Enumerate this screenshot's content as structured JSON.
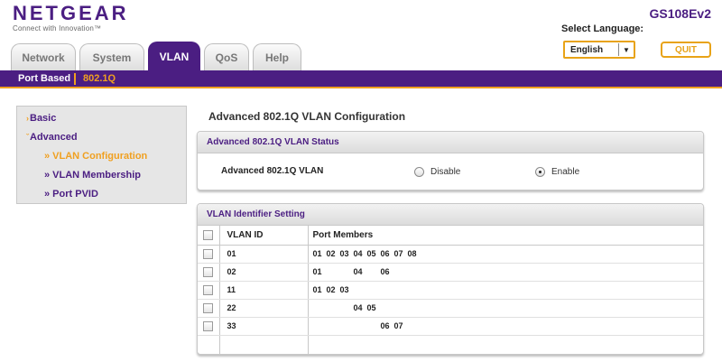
{
  "header": {
    "brand": "NETGEAR",
    "tagline": "Connect with Innovation™",
    "model": "GS108Ev2",
    "language_label": "Select Language:",
    "language_value": "English",
    "quit_label": "QUIT"
  },
  "tabs": [
    {
      "label": "Network",
      "active": false
    },
    {
      "label": "System",
      "active": false
    },
    {
      "label": "VLAN",
      "active": true
    },
    {
      "label": "QoS",
      "active": false
    },
    {
      "label": "Help",
      "active": false
    }
  ],
  "subnav": {
    "port_based": "Port Based",
    "dot1q": "802.1Q"
  },
  "leftmenu": {
    "basic": "Basic",
    "advanced": "Advanced",
    "vlan_configuration": "» VLAN Configuration",
    "vlan_membership": "» VLAN Membership",
    "port_pvid": "» Port PVID"
  },
  "main": {
    "title": "Advanced 802.1Q VLAN Configuration",
    "status_panel": {
      "heading": "Advanced 802.1Q VLAN Status",
      "label": "Advanced 802.1Q VLAN",
      "disable": "Disable",
      "enable": "Enable",
      "selected": "enable"
    },
    "vlan_panel": {
      "heading": "VLAN Identifier Setting",
      "col_vlan_id": "VLAN ID",
      "col_port_members": "Port Members",
      "rows": [
        {
          "id": "01",
          "ports": [
            "01",
            "02",
            "03",
            "04",
            "05",
            "06",
            "07",
            "08"
          ]
        },
        {
          "id": "02",
          "ports": [
            "01",
            "",
            "",
            "04",
            "",
            "06",
            "",
            ""
          ]
        },
        {
          "id": "11",
          "ports": [
            "01",
            "02",
            "03",
            "",
            "",
            "",
            "",
            ""
          ]
        },
        {
          "id": "22",
          "ports": [
            "",
            "",
            "",
            "04",
            "05",
            "",
            "",
            ""
          ]
        },
        {
          "id": "33",
          "ports": [
            "",
            "",
            "",
            "",
            "",
            "06",
            "07",
            ""
          ]
        }
      ]
    }
  },
  "colors": {
    "brand_purple": "#4b1e82",
    "accent_orange": "#f0a020"
  }
}
